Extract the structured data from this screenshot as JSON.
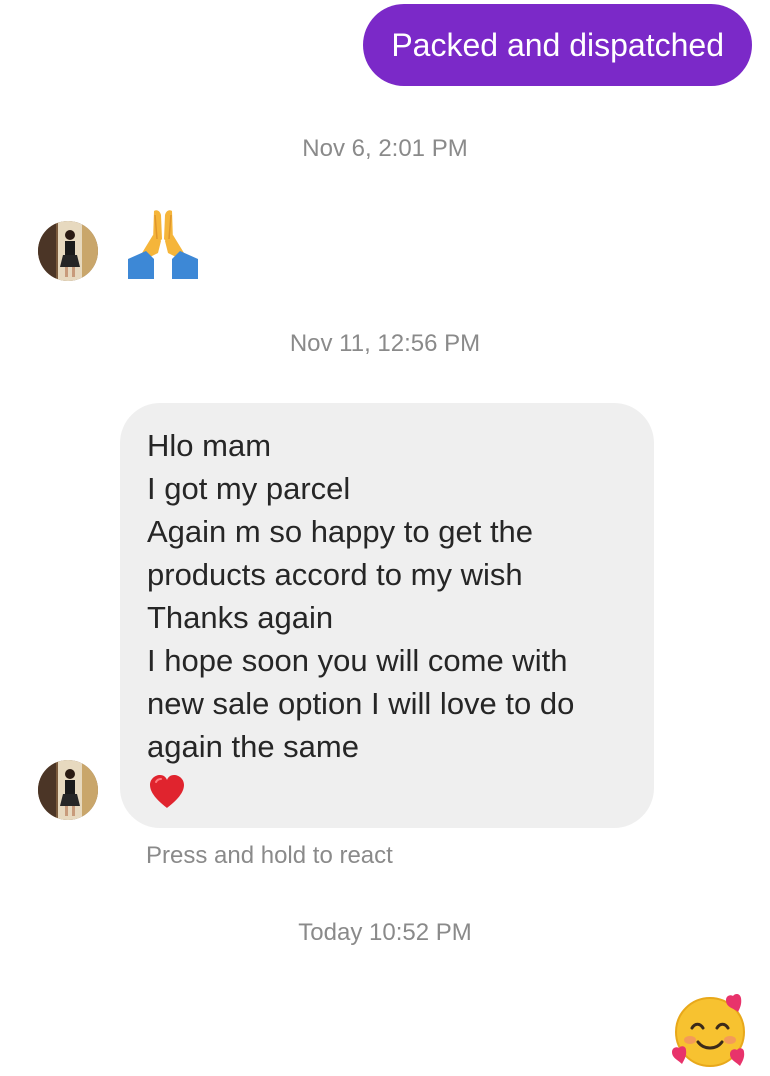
{
  "messages": {
    "sent": {
      "text": "Packed and dispatched",
      "bubble_color": "#7b29c8"
    },
    "timestamps": [
      "Nov 6, 2:01 PM",
      "Nov 11, 12:56 PM",
      "Today 10:52 PM"
    ],
    "reaction_emoji": {
      "icon": "folded-hands-emoji"
    },
    "received": {
      "lines": [
        "Hlo mam",
        "I got my parcel",
        "Again m so happy to get the",
        "products accord to my wish",
        "Thanks again",
        "I hope soon you will come with",
        "new sale option I will love to do",
        "again the same"
      ],
      "heart_icon": "red-heart-emoji",
      "bubble_color": "#efefef"
    },
    "hint": "Press and hold to react",
    "final_emoji": {
      "icon": "smiling-face-with-hearts-emoji"
    }
  },
  "contact": {
    "avatar_icon": "profile-avatar"
  }
}
